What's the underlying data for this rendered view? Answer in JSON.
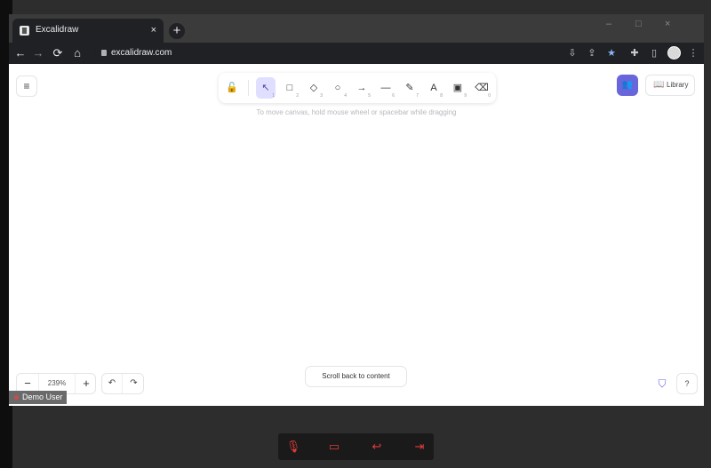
{
  "browser": {
    "tab_title": "Excalidraw",
    "tab_close": "×",
    "new_tab": "+",
    "url": "excalidraw.com",
    "window_controls": {
      "minimize": "–",
      "restore": "□",
      "close": "×"
    }
  },
  "toolbar_icons": {
    "back": "←",
    "forward": "→",
    "reload": "⟳",
    "home": "⌂",
    "install": "⇩",
    "share": "⇪",
    "bookmark": "★",
    "extensions": "✚",
    "sidepanel": "▯",
    "menu": "⋮"
  },
  "canvas": {
    "hint": "To move canvas, hold mouse wheel or spacebar while dragging",
    "menu_icon": "≡",
    "lock_icon": "🔓",
    "tools": [
      {
        "name": "selection",
        "icon": "↖",
        "key": "1",
        "active": true
      },
      {
        "name": "rectangle",
        "icon": "□",
        "key": "2",
        "active": false
      },
      {
        "name": "diamond",
        "icon": "◇",
        "key": "3",
        "active": false
      },
      {
        "name": "ellipse",
        "icon": "○",
        "key": "4",
        "active": false
      },
      {
        "name": "arrow",
        "icon": "→",
        "key": "5",
        "active": false
      },
      {
        "name": "line",
        "icon": "—",
        "key": "6",
        "active": false
      },
      {
        "name": "draw",
        "icon": "✎",
        "key": "7",
        "active": false
      },
      {
        "name": "text",
        "icon": "A",
        "key": "8",
        "active": false
      },
      {
        "name": "image",
        "icon": "▣",
        "key": "9",
        "active": false
      },
      {
        "name": "eraser",
        "icon": "⌫",
        "key": "0",
        "active": false
      }
    ],
    "collab_icon": "👥",
    "library_icon": "📖",
    "library_label": "Library",
    "zoom": {
      "minus": "−",
      "value": "239%",
      "plus": "+"
    },
    "undo": "↶",
    "redo": "↷",
    "scroll_back": "Scroll back to content",
    "shield_icon": "⛉",
    "help": "?",
    "user_name": "Demo User"
  },
  "call": {
    "mic_off": "🎙",
    "camera_off": "▭",
    "reply": "↩",
    "leave": "⇥"
  },
  "colors": {
    "accent": "#6965db",
    "active_tool_bg": "#e0dfff",
    "call_red": "#e33b3b"
  }
}
